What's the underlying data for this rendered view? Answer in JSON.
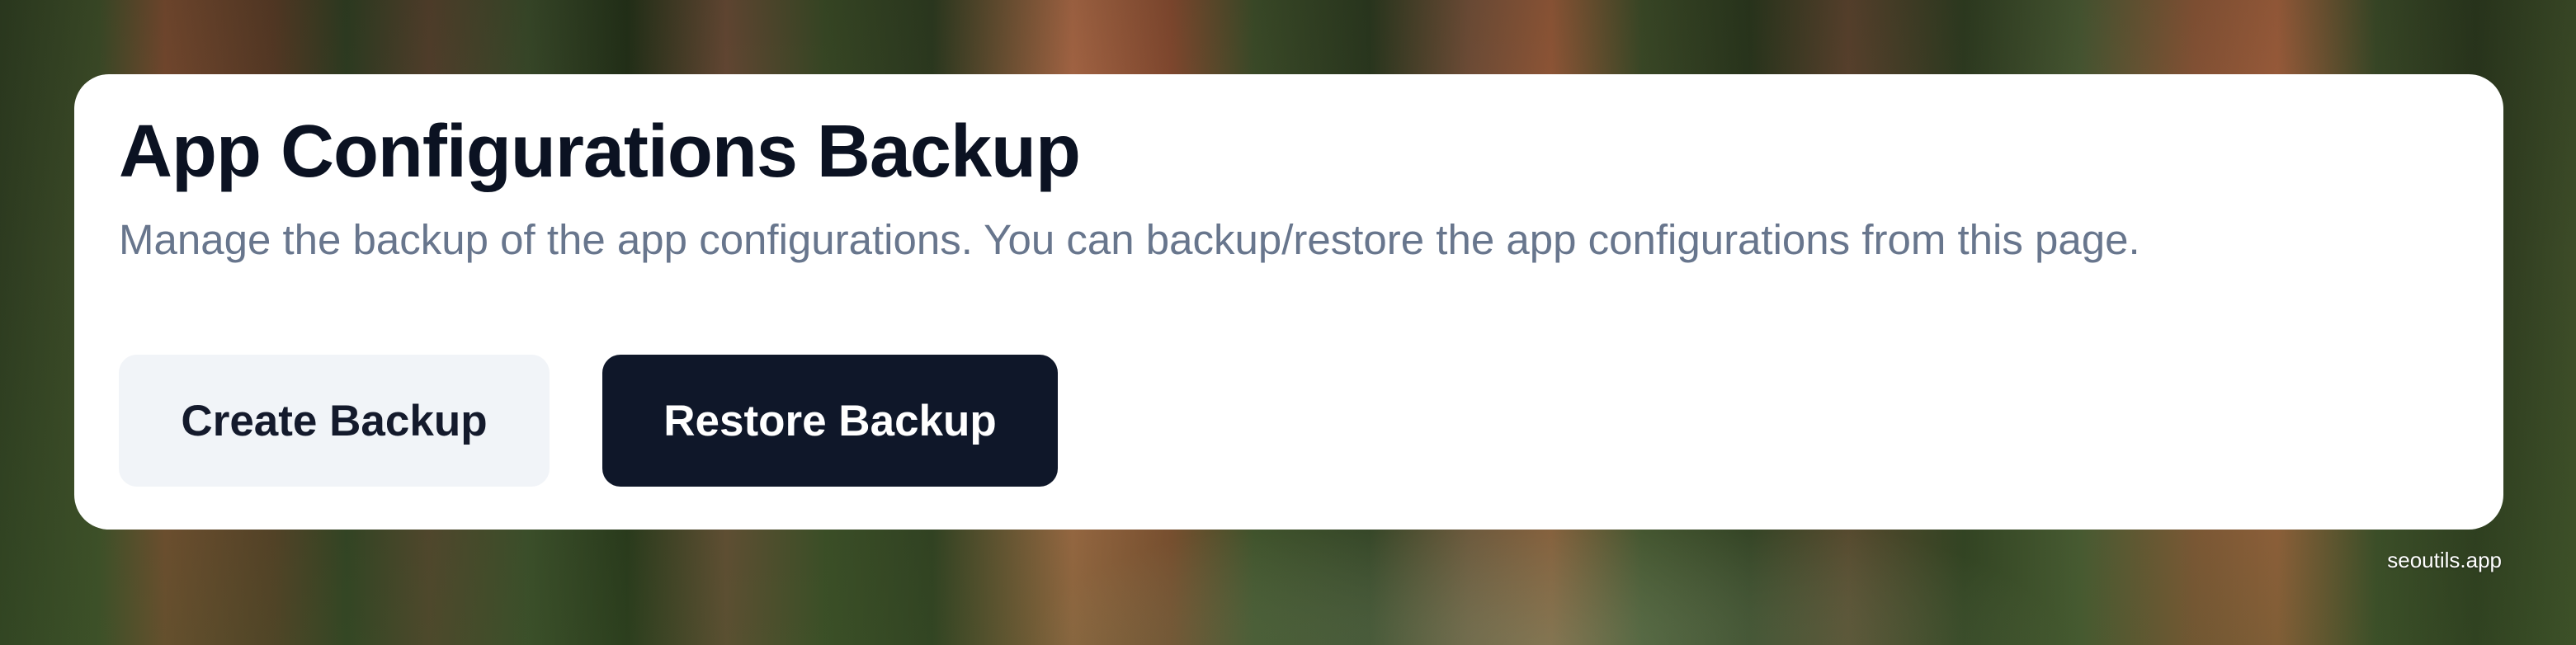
{
  "page": {
    "title": "App Configurations Backup",
    "description": "Manage the backup of the app configurations. You can backup/restore the app configurations from this page."
  },
  "actions": {
    "create_label": "Create Backup",
    "restore_label": "Restore Backup"
  },
  "footer": {
    "brand": "seoutils.app"
  },
  "colors": {
    "primary_button": "#0f1729",
    "secondary_button": "#f1f4f8",
    "muted_text": "#68768d"
  }
}
